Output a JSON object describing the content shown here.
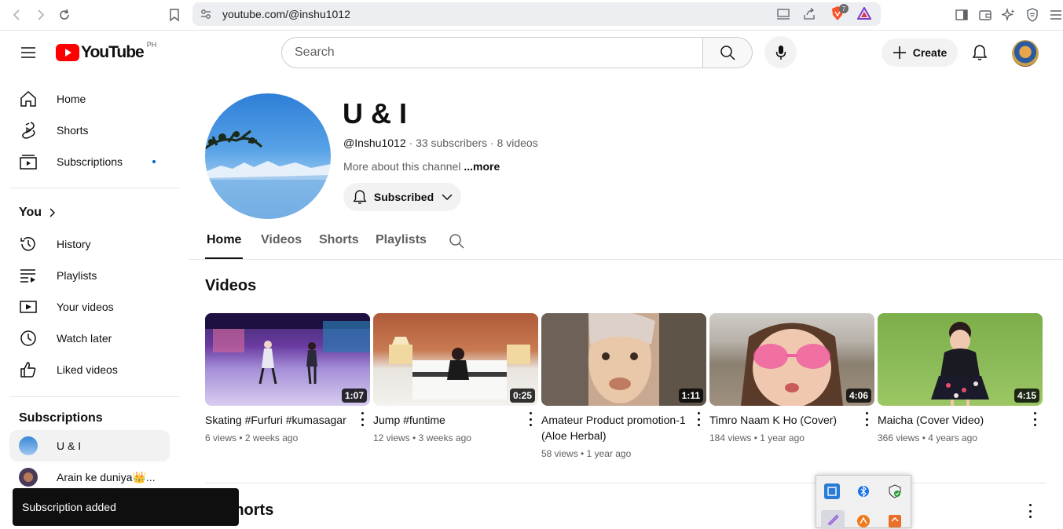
{
  "browser": {
    "url": "youtube.com/@inshu1012",
    "brave_badge": "7"
  },
  "header": {
    "logo_text": "YouTube",
    "region": "PH",
    "search_placeholder": "Search",
    "create_label": "Create"
  },
  "sidebar": {
    "main": [
      {
        "label": "Home",
        "icon": "home-icon"
      },
      {
        "label": "Shorts",
        "icon": "shorts-icon"
      },
      {
        "label": "Subscriptions",
        "icon": "subscriptions-icon"
      }
    ],
    "you_heading": "You",
    "you": [
      {
        "label": "History",
        "icon": "history-icon"
      },
      {
        "label": "Playlists",
        "icon": "playlists-icon"
      },
      {
        "label": "Your videos",
        "icon": "your-videos-icon"
      },
      {
        "label": "Watch later",
        "icon": "watch-later-icon"
      },
      {
        "label": "Liked videos",
        "icon": "liked-videos-icon"
      }
    ],
    "subs_heading": "Subscriptions",
    "subs": [
      {
        "label": "U & I"
      },
      {
        "label": "Arain ke duniya👑..."
      }
    ]
  },
  "channel": {
    "name": "U & I",
    "handle": "@Inshu1012",
    "subscribers": "33 subscribers",
    "videos_count": "8 videos",
    "separator": "·",
    "about": "More about this channel",
    "more": "...more",
    "subscribed_label": "Subscribed"
  },
  "tabs": [
    "Home",
    "Videos",
    "Shorts",
    "Playlists"
  ],
  "sections": {
    "videos_heading": "Videos",
    "shorts_heading": "Shorts"
  },
  "videos": [
    {
      "title": "Skating #Furfuri #kumasagar",
      "duration": "1:07",
      "meta": "6 views • 2 weeks ago"
    },
    {
      "title": "Jump #funtime",
      "duration": "0:25",
      "meta": "12 views • 3 weeks ago"
    },
    {
      "title": "Amateur Product promotion-1 (Aloe Herbal)",
      "duration": "1:11",
      "meta": "58 views • 1 year ago"
    },
    {
      "title": "Timro Naam K Ho (Cover)",
      "duration": "4:06",
      "meta": "184 views • 1 year ago"
    },
    {
      "title": "Maicha (Cover Video)",
      "duration": "4:15",
      "meta": "366 views • 4 years ago"
    }
  ],
  "toast": {
    "text": "Subscription added"
  },
  "colors": {
    "brand_red": "#ff0000",
    "toast_bg": "#0f0f0f",
    "sub_dot": "#065fd4"
  }
}
